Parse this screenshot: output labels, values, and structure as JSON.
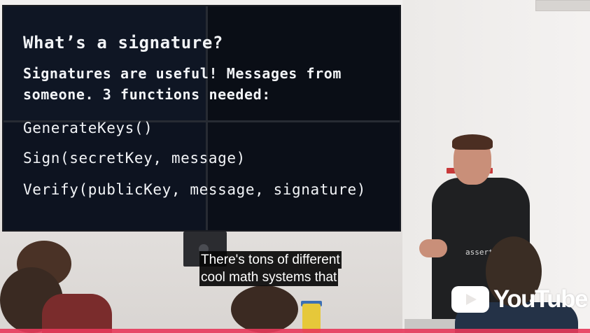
{
  "slide": {
    "title": "What’s a signature?",
    "line1": "Signatures are useful! Messages from",
    "line2": "someone.  3 functions needed:",
    "functions": [
      "GenerateKeys()",
      "Sign(secretKey, message)",
      "Verify(publicKey, message, signature)"
    ]
  },
  "presenter": {
    "shirt_text": "assert(0)"
  },
  "captions": [
    "There's tons of different",
    "cool math systems that"
  ],
  "watermark": {
    "label": "YouTube",
    "icon": "play-icon"
  },
  "colors": {
    "caption_bg": "#080808",
    "slide_bg": "#0b1019",
    "slide_text": "#f2f4f7"
  }
}
